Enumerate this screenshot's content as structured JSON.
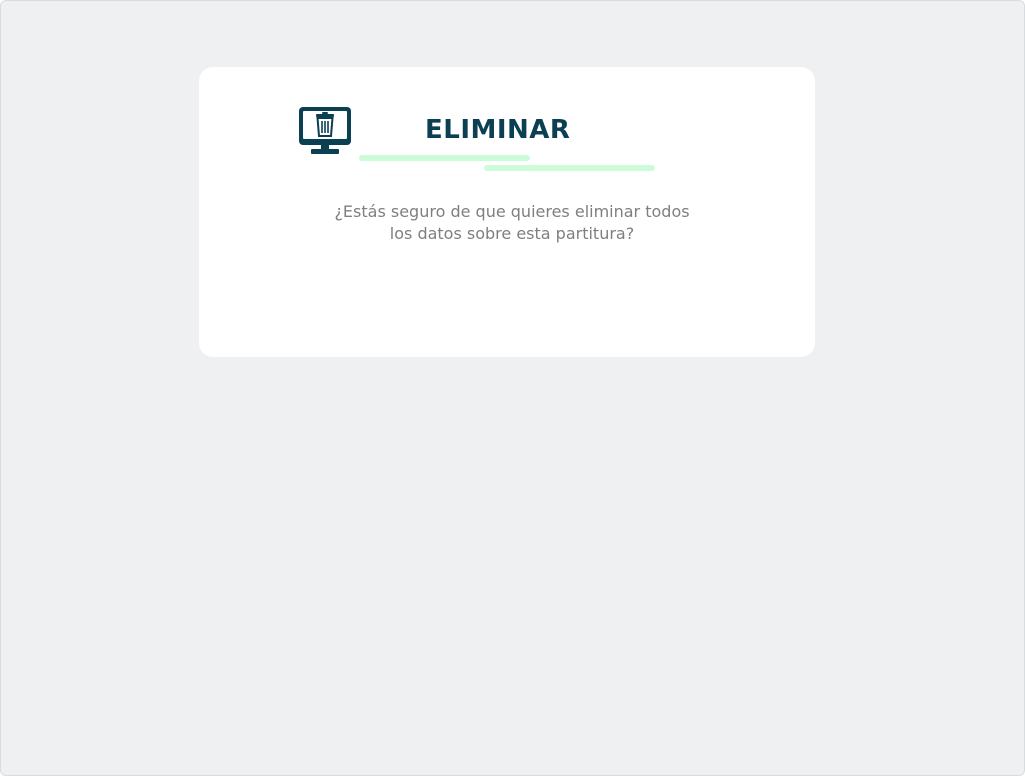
{
  "dialog": {
    "title": "ELIMINAR",
    "icon": "monitor-trash-icon",
    "message_line1": "¿Estás seguro de que quieres eliminar todos",
    "message_line2": "los datos sobre esta partitura?"
  },
  "colors": {
    "background": "#eff0f2",
    "card": "#ffffff",
    "title": "#0b3f52",
    "accent_underline": "#cdfbd8",
    "message_text": "#7d7f81"
  }
}
